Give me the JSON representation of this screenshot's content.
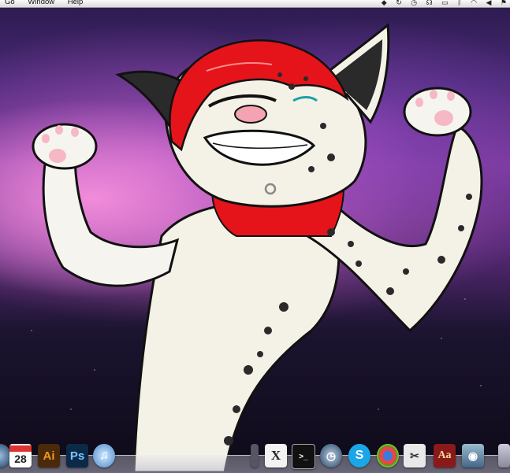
{
  "menubar": {
    "items": [
      "Go",
      "Window",
      "Help"
    ],
    "status_icons": [
      "dropbox-icon",
      "sync-icon",
      "clock-icon",
      "headphones-icon",
      "screen-icon",
      "bluetooth-icon",
      "wifi-icon",
      "volume-icon",
      "flag-icon"
    ]
  },
  "dock": {
    "calendar": {
      "month": "",
      "day": "28"
    },
    "illustrator": "Ai",
    "photoshop": "Ps",
    "textedit": "X",
    "dictionary": "Aa"
  },
  "colors": {
    "accent_red": "#e4141a",
    "fur": "#f4f1e6",
    "illustrator_bg": "#f19a1b",
    "photoshop_bg": "#2d6fb0"
  }
}
